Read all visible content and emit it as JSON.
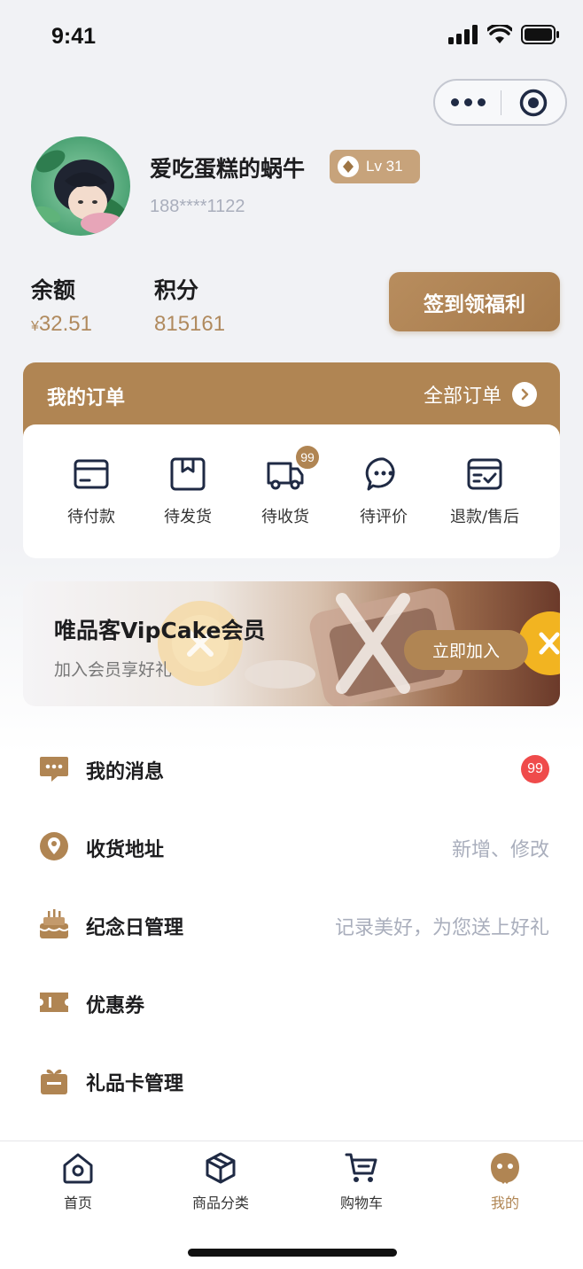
{
  "status_bar": {
    "time": "9:41"
  },
  "profile": {
    "username": "爱吃蛋糕的蜗牛",
    "level": "Lv 31",
    "phone": "188****1122"
  },
  "stats": {
    "balance_label": "余额",
    "balance_currency": "¥",
    "balance_value": "32.51",
    "points_label": "积分",
    "points_value": "815161",
    "signin_label": "签到领福利"
  },
  "orders": {
    "title": "我的订单",
    "all_label": "全部订单",
    "items": [
      {
        "label": "待付款",
        "icon": "wallet-icon"
      },
      {
        "label": "待发货",
        "icon": "package-icon"
      },
      {
        "label": "待收货",
        "icon": "truck-icon",
        "badge": "99"
      },
      {
        "label": "待评价",
        "icon": "chat-bubble-icon"
      },
      {
        "label": "退款/售后",
        "icon": "refund-box-icon"
      }
    ]
  },
  "banner": {
    "title": "唯品客VipCake会员",
    "subtitle": "加入会员享好礼",
    "button": "立即加入"
  },
  "menu": [
    {
      "label": "我的消息",
      "icon": "message-icon",
      "badge": "99"
    },
    {
      "label": "收货地址",
      "icon": "location-icon",
      "hint": "新增、修改"
    },
    {
      "label": "纪念日管理",
      "icon": "cake-icon",
      "hint": "记录美好，为您送上好礼"
    },
    {
      "label": "优惠券",
      "icon": "coupon-icon"
    },
    {
      "label": "礼品卡管理",
      "icon": "gift-icon"
    }
  ],
  "tabbar": [
    {
      "label": "首页",
      "icon": "home-icon"
    },
    {
      "label": "商品分类",
      "icon": "category-box-icon"
    },
    {
      "label": "购物车",
      "icon": "cart-icon"
    },
    {
      "label": "我的",
      "icon": "profile-icon",
      "active": true
    }
  ],
  "colors": {
    "brand": "#b08553",
    "badge_red": "#ef4b4b",
    "muted": "#a9aebc",
    "icon_dark": "#1f2a44"
  }
}
